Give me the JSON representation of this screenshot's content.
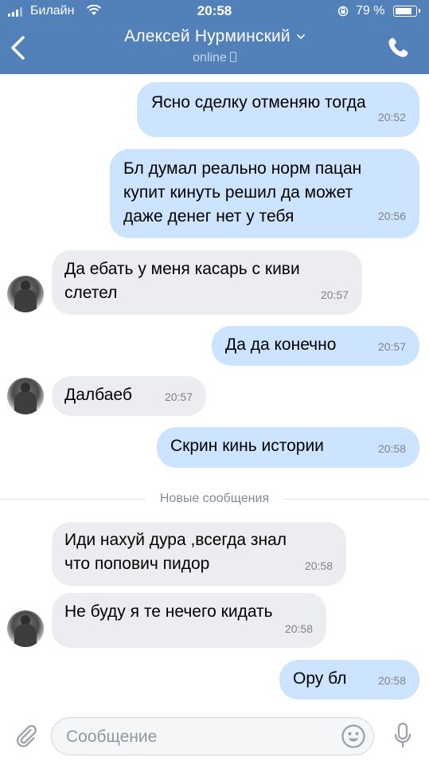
{
  "status_bar": {
    "carrier": "Билайн",
    "time": "20:58",
    "battery": "79 %"
  },
  "header": {
    "title": "Алексей Нурминский",
    "subtitle": "online",
    "back_icon": "chevron-left-icon",
    "call_icon": "phone-icon",
    "color": "#5181b8"
  },
  "messages": [
    {
      "dir": "out",
      "text": "Ясно сделку отменяю тогда",
      "time": "20:52"
    },
    {
      "dir": "out",
      "text": "Бл думал реально норм пацан\nкупит кинуть решил да может\nдаже денег нет у тебя",
      "time": "20:56"
    },
    {
      "dir": "in",
      "text": "Да ебать у меня касарь с киви\nслетел",
      "time": "20:57"
    },
    {
      "dir": "out",
      "text": "Да да конечно",
      "time": "20:57"
    },
    {
      "dir": "in",
      "text": "Далбаеб",
      "time": "20:57"
    },
    {
      "dir": "out",
      "text": "Скрин кинь истории",
      "time": "20:58"
    },
    {
      "dir": "in",
      "text": "Иди нахуй дура ,всегда знал\nчто попович пидор",
      "time": "20:58"
    },
    {
      "dir": "in",
      "text": "Не буду я те нечего кидать",
      "time": "20:58"
    },
    {
      "dir": "out",
      "text": "Ору бл",
      "time": "20:58"
    }
  ],
  "divider": {
    "label": "Новые сообщения"
  },
  "composer": {
    "placeholder": "Сообщение",
    "attach_icon": "paperclip-icon",
    "emoji_icon": "smiley-icon",
    "mic_icon": "microphone-icon"
  },
  "colors": {
    "outgoing_bubble": "#cce4ff",
    "incoming_bubble": "#ebedf0"
  }
}
